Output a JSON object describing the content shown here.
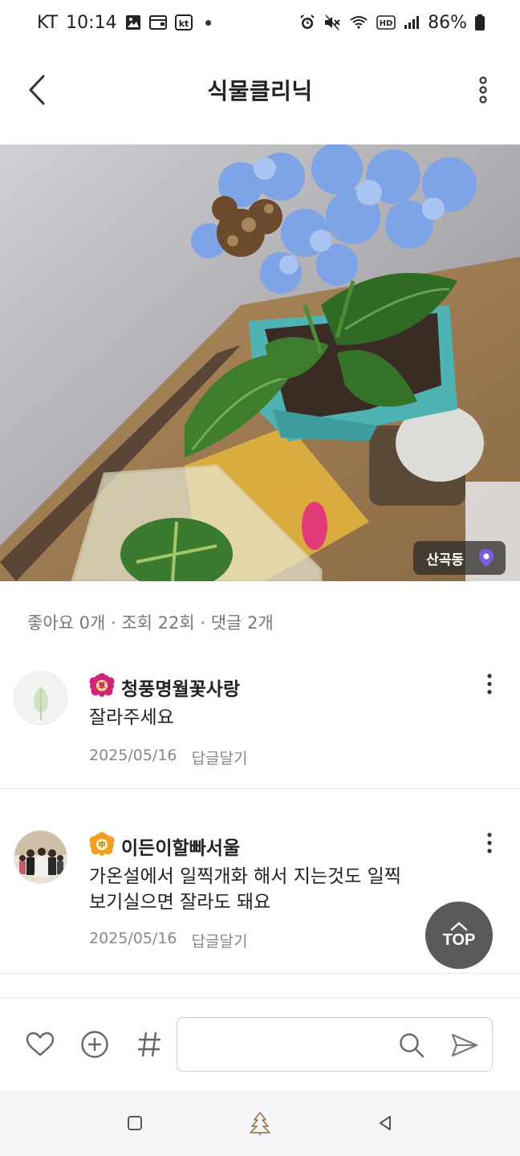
{
  "status_bar": {
    "carrier": "KT",
    "time": "10:14",
    "battery": "86%"
  },
  "header": {
    "title": "식물클리닉"
  },
  "photo": {
    "location": "산곡동"
  },
  "stats": {
    "text": "좋아요 0개 · 조회 22회 · 댓글 2개"
  },
  "comments": [
    {
      "author": "청풍명월꽃사랑",
      "badge_char": "草",
      "text_lines": [
        "잘라주세요"
      ],
      "date": "2025/05/16",
      "reply": "답글달기"
    },
    {
      "author": "이든이할빠서울",
      "badge_char": "中",
      "text_lines": [
        "가온설에서 일찍개화 해서 지는것도 일찍",
        "보기실으면 잘라도 돼요"
      ],
      "date": "2025/05/16",
      "reply": "답글달기"
    }
  ],
  "top_button": {
    "label": "TOP"
  },
  "input": {
    "placeholder": ""
  },
  "colors": {
    "badge_pink": "#d2247a",
    "badge_orange": "#f0a01e",
    "location_pin": "#7c5ce0",
    "top_bg": "#5a5a5a"
  }
}
